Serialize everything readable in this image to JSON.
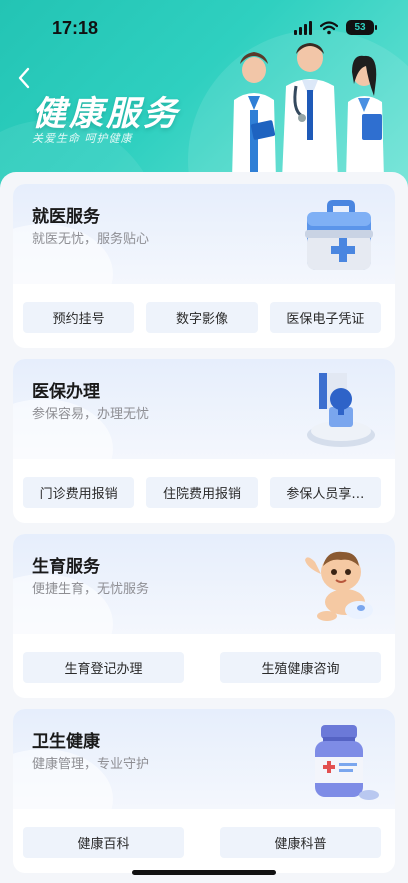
{
  "status_bar": {
    "time": "17:18",
    "battery": "53"
  },
  "header": {
    "title": "健康服务",
    "subtitle": "关爱生命 呵护健康"
  },
  "cards": [
    {
      "title": "就医服务",
      "desc": "就医无忧，服务贴心",
      "art": "first-aid-kit-icon",
      "buttons": [
        "预约挂号",
        "数字影像",
        "医保电子凭证"
      ]
    },
    {
      "title": "医保办理",
      "desc": "参保容易，办理无忧",
      "art": "stamp-icon",
      "buttons": [
        "门诊费用报销",
        "住院费用报销",
        "参保人员享…"
      ]
    },
    {
      "title": "生育服务",
      "desc": "便捷生育，无忧服务",
      "art": "baby-icon",
      "buttons": [
        "生育登记办理",
        "生殖健康咨询"
      ]
    },
    {
      "title": "卫生健康",
      "desc": "健康管理，专业守护",
      "art": "medicine-bottle-icon",
      "buttons": [
        "健康百科",
        "健康科普"
      ]
    }
  ],
  "colors": {
    "accent": "#2fd0c0",
    "card_bg": "#e6eefc",
    "button_bg": "#eef3fb"
  }
}
